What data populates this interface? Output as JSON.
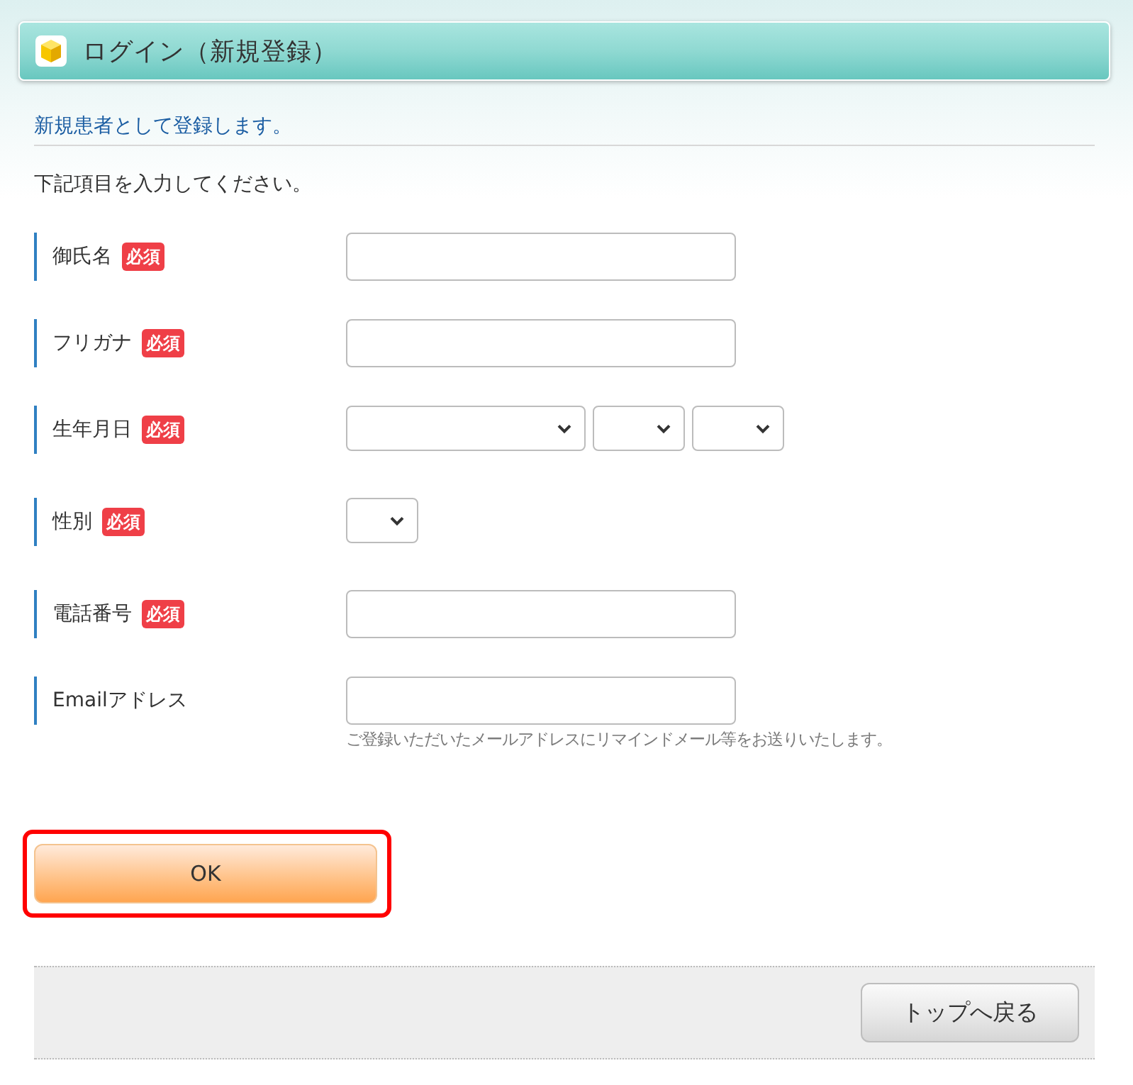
{
  "title_bar": {
    "title": "ログイン（新規登録）"
  },
  "intro": {
    "heading": "新規患者として登録します。",
    "instruction": "下記項目を入力してください。"
  },
  "fields": [
    {
      "label": "御氏名",
      "badge": "必須",
      "kind": "text"
    },
    {
      "label": "フリガナ",
      "badge": "必須",
      "kind": "text"
    },
    {
      "label": "生年月日",
      "badge": "必須",
      "kind": "date"
    },
    {
      "label": "性別",
      "badge": "必須",
      "kind": "choice"
    },
    {
      "label": "電話番号",
      "badge": "必須",
      "kind": "text"
    },
    {
      "label": "Emailアドレス",
      "kind": "text",
      "note": "ご登録いただいたメールアドレスにリマインドメール等をお送りいたします。"
    }
  ],
  "submit": {
    "label": "OK",
    "highlighted": true
  },
  "footer": {
    "back_button": "トップへ戻る"
  }
}
